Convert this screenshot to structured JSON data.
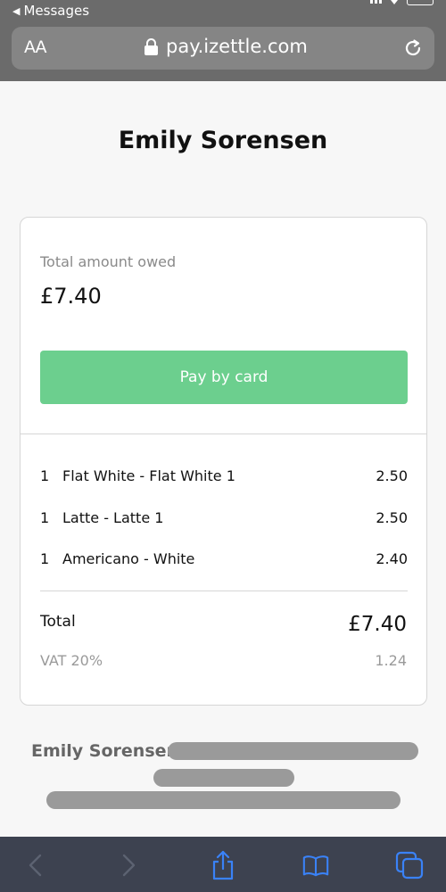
{
  "status_bar": {
    "back_label": "Messages"
  },
  "browser": {
    "text_size_label": "AA",
    "url": "pay.izettle.com"
  },
  "page": {
    "title": "Emily Sorensen"
  },
  "summary": {
    "owed_label": "Total amount owed",
    "owed_amount": "£7.40",
    "pay_button": "Pay by card"
  },
  "items": [
    {
      "qty": "1",
      "name": "Flat White - Flat White 1",
      "price": "2.50"
    },
    {
      "qty": "1",
      "name": "Latte - Latte 1",
      "price": "2.50"
    },
    {
      "qty": "1",
      "name": "Americano - White",
      "price": "2.40"
    }
  ],
  "totals": {
    "total_label": "Total",
    "total_value": "£7.40",
    "vat_label": "VAT 20%",
    "vat_value": "1.24"
  },
  "footer": {
    "merchant_name": "Emily Sorensen"
  },
  "toolbar": {
    "icons": [
      "back-icon",
      "forward-icon",
      "share-icon",
      "bookmarks-icon",
      "tabs-icon"
    ]
  },
  "colors": {
    "accent": "#6ccf8e",
    "chrome": "#6b6b6b",
    "toolbar": "#3d4250",
    "icon_blue": "#3a82f7"
  }
}
